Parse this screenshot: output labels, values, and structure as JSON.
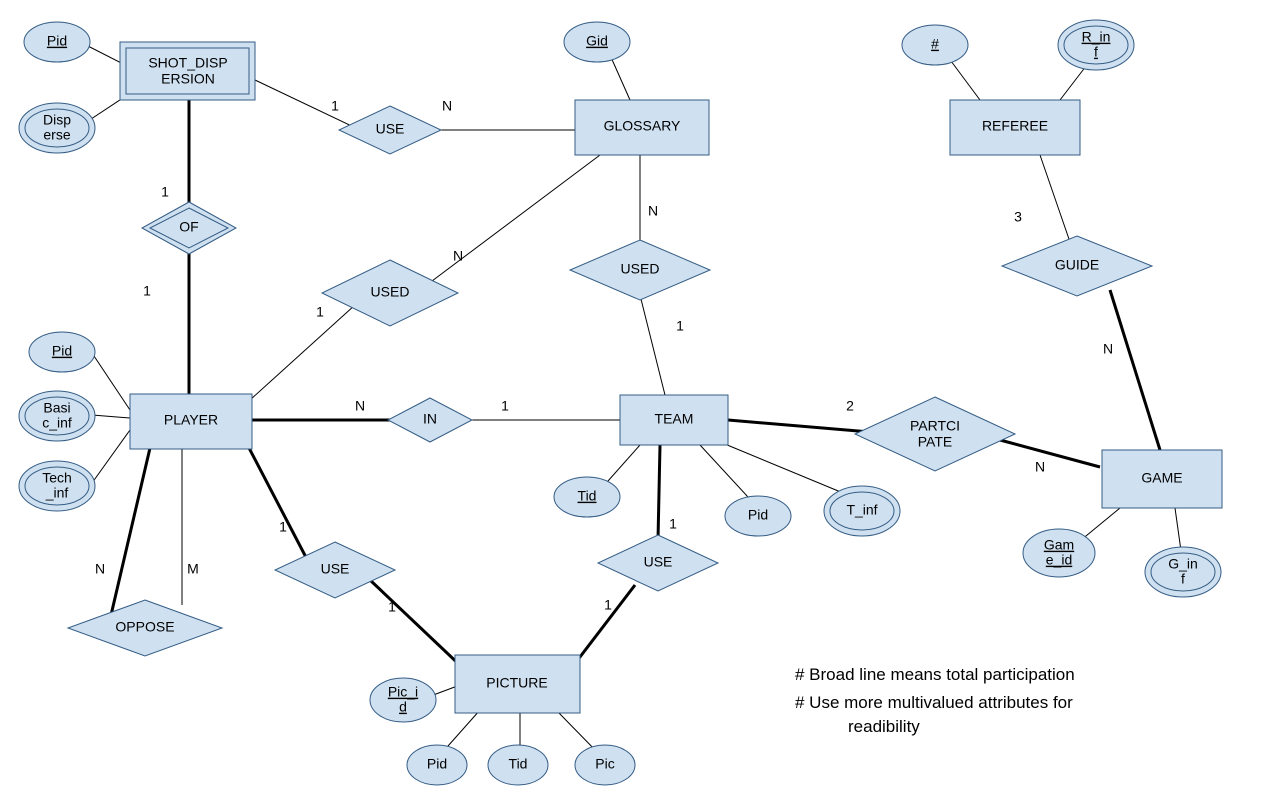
{
  "entities": {
    "shot_dispersion": "SHOT_DISP",
    "shot_dispersion2": "ERSION",
    "player": "PLAYER",
    "glossary": "GLOSSARY",
    "team": "TEAM",
    "picture": "PICTURE",
    "referee": "REFEREE",
    "game": "GAME"
  },
  "relationships": {
    "of": "OF",
    "use1": "USE",
    "used1": "USED",
    "used2": "USED",
    "in": "IN",
    "oppose": "OPPOSE",
    "use2": "USE",
    "use3": "USE",
    "participate1": "PARTCI",
    "participate2": "PATE",
    "guide": "GUIDE"
  },
  "attributes": {
    "sd_pid": "Pid",
    "disperse1": "Disp",
    "disperse2": "erse",
    "gid": "Gid",
    "p_pid": "Pid",
    "basic_inf1": "Basi",
    "basic_inf2": "c_inf",
    "tech_inf1": "Tech",
    "tech_inf2": "_inf",
    "tid": "Tid",
    "t_pid": "Pid",
    "t_inf": "T_inf",
    "pic_id1": "Pic_i",
    "pic_id2": "d",
    "pic_pid": "Pid",
    "pic_tid": "Tid",
    "pic": "Pic",
    "ref_num": "#",
    "r_inf1": "R_in",
    "r_inf2": "f",
    "game_id1": "Gam",
    "game_id2": "e_id",
    "g_inf1": "G_in",
    "g_inf2": "f"
  },
  "cardinalities": {
    "sd_of": "1",
    "player_of": "1",
    "sd_use": "1",
    "glossary_use": "N",
    "glossary_used1": "N",
    "player_used1": "1",
    "glossary_used2": "N",
    "team_used2": "1",
    "player_in": "N",
    "team_in": "1",
    "oppose_n": "N",
    "oppose_m": "M",
    "player_use2": "1",
    "picture_use2": "1",
    "team_use3": "1",
    "picture_use3": "1",
    "team_participate": "2",
    "game_participate": "N",
    "referee_guide": "3",
    "game_guide": "N"
  },
  "notes": {
    "line1": "# Broad line means  total participation",
    "line2": "# Use more multivalued attributes for",
    "line3": "readibility"
  }
}
